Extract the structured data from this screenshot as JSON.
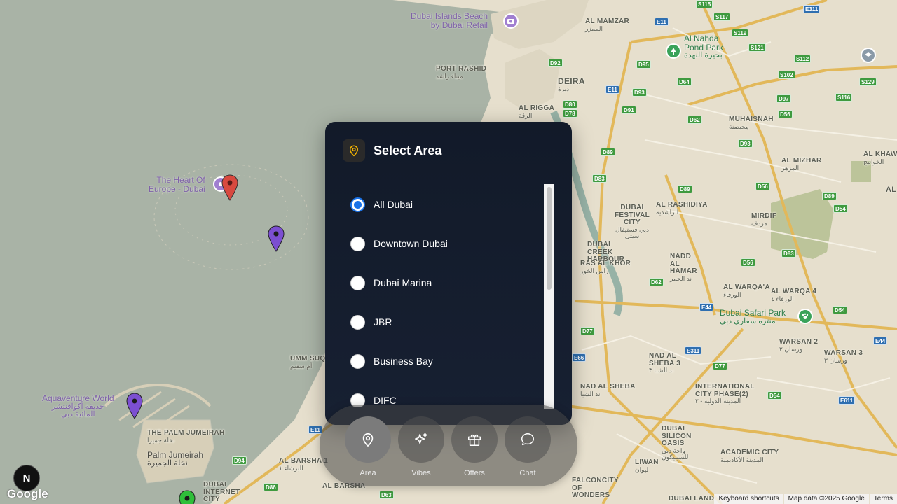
{
  "map": {
    "places": [
      {
        "en": "PORT RASHID",
        "ar": "ميناء راشد"
      },
      {
        "en": "DEIRA",
        "ar": "ديرة"
      },
      {
        "en": "AL RIGGA",
        "ar": "الرقة"
      },
      {
        "en": "AL MAMZAR",
        "ar": "الممزر"
      },
      {
        "en": "MUHAISNAH",
        "ar": "محيصنة"
      },
      {
        "en": "AL MIZHAR",
        "ar": "المزهر"
      },
      {
        "en": "AL KHAWANEEJ",
        "ar": "الخوانيج"
      },
      {
        "en": "AL RASHIDIYA",
        "ar": "الراشدية"
      },
      {
        "en": "MIRDIF",
        "ar": "مردف"
      },
      {
        "en": "DUBAI FESTIVAL CITY",
        "ar": "دبي فستيفال سيتي"
      },
      {
        "en": "DUBAI CREEK HARBOUR",
        "ar": ""
      },
      {
        "en": "RAS AL KHOR",
        "ar": "راس الخور"
      },
      {
        "en": "NADD AL HAMAR",
        "ar": "ند الحمر"
      },
      {
        "en": "AL WARQA'A",
        "ar": "الورقاء"
      },
      {
        "en": "AL WARQA 4",
        "ar": "الورقاء ٤"
      },
      {
        "en": "WARSAN 2",
        "ar": "ورسان ٢"
      },
      {
        "en": "WARSAN 3",
        "ar": "ورسان ٣"
      },
      {
        "en": "NAD AL SHEBA 3",
        "ar": "ند الشبا ٣"
      },
      {
        "en": "NAD AL SHEBA",
        "ar": "ند الشبا"
      },
      {
        "en": "INTERNATIONAL CITY PHASE(2)",
        "ar": "المدينة الدولية - ٢"
      },
      {
        "en": "DUBAI SILICON OASIS",
        "ar": "واحة دبي للسيليكون"
      },
      {
        "en": "ACADEMIC CITY",
        "ar": "المدينة الأكاديمية"
      },
      {
        "en": "LIWAN",
        "ar": "ليوان"
      },
      {
        "en": "FALCONCITY OF WONDERS",
        "ar": ""
      },
      {
        "en": "DUBAI LAND",
        "ar": ""
      },
      {
        "en": "AL BARSHA 1",
        "ar": "البرشاء ١"
      },
      {
        "en": "AL BARSHA",
        "ar": ""
      },
      {
        "en": "DUBAI INTERNET CITY",
        "ar": ""
      },
      {
        "en": "THE PALM JUMEIRAH",
        "ar": "نخلة جميرا"
      },
      {
        "en": "UMM SUQ",
        "ar": "أم سقيم"
      },
      {
        "en": "AL",
        "ar": ""
      }
    ],
    "pois": [
      {
        "en": "Dubai Islands Beach",
        "en2": "by Dubai Retail",
        "type": "purple"
      },
      {
        "en": "The Heart Of",
        "en2": "Europe - Dubai",
        "type": "purple"
      },
      {
        "en": "Aquaventure World",
        "ar": "حديقة أكوافنتشر",
        "ar2": "المائية دبي",
        "type": "purple"
      },
      {
        "en": "Palm Jumeirah",
        "ar": "نخلة الجميرة",
        "type": "plain"
      },
      {
        "en": "Al Nahda",
        "en2": "Pond Park",
        "ar": "بحيرة النهدة",
        "type": "green"
      },
      {
        "en": "Dubai Safari Park",
        "ar": "منتزه سفاري دبي",
        "type": "green"
      }
    ],
    "roads": [
      "E11",
      "E11",
      "D92",
      "D95",
      "D80",
      "D78",
      "D93",
      "D91",
      "D89",
      "D83",
      "D62",
      "D64",
      "D93",
      "D89",
      "D56",
      "D89",
      "D54",
      "D83",
      "D56",
      "D62",
      "E44",
      "D54",
      "E44",
      "D77",
      "E66",
      "E311",
      "D77",
      "D54",
      "E611",
      "D94",
      "D86",
      "D63",
      "S115",
      "S117",
      "E311",
      "S119",
      "S121",
      "S112",
      "S102",
      "S129",
      "D97",
      "S116",
      "D56",
      "E11"
    ],
    "pins": [
      "red",
      "purple",
      "purple",
      "green"
    ],
    "attribution": {
      "keyboard": "Keyboard shortcuts",
      "data": "Map data ©2025 Google",
      "terms": "Terms"
    },
    "google_logo": "Google",
    "badge_letter": "N"
  },
  "panel": {
    "title": "Select Area",
    "icon": "map-pin-icon",
    "selected": "All Dubai",
    "areas": [
      "All Dubai",
      "Downtown Dubai",
      "Dubai Marina",
      "JBR",
      "Business Bay",
      "DIFC"
    ]
  },
  "nav": {
    "active": "Area",
    "items": [
      {
        "label": "Area",
        "icon": "map-pin-icon"
      },
      {
        "label": "Vibes",
        "icon": "sparkles-icon"
      },
      {
        "label": "Offers",
        "icon": "gift-icon"
      },
      {
        "label": "Chat",
        "icon": "chat-bubble-icon"
      }
    ]
  },
  "colors": {
    "accent": "#f4b400",
    "radio_selected": "#1a73e8",
    "panel_bg": "#141c2b"
  }
}
